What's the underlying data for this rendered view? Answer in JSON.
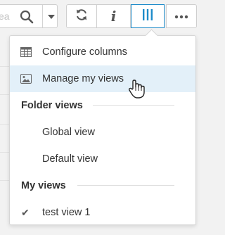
{
  "toolbar": {
    "search_partial_text": "ea",
    "buttons": [
      {
        "name": "refresh",
        "icon": "refresh-icon"
      },
      {
        "name": "info",
        "icon": "info-icon",
        "glyph": "i"
      },
      {
        "name": "columns",
        "icon": "columns-icon",
        "active": true
      },
      {
        "name": "more",
        "icon": "more-icon"
      }
    ]
  },
  "menu": {
    "items": [
      {
        "label": "Configure columns",
        "icon": "table-icon"
      },
      {
        "label": "Manage my views",
        "icon": "image-icon",
        "hovered": true
      }
    ],
    "folder_views": {
      "header": "Folder views",
      "items": [
        {
          "label": "Global view"
        },
        {
          "label": "Default view"
        }
      ]
    },
    "my_views": {
      "header": "My views",
      "items": [
        {
          "label": "test view 1",
          "checked": true
        }
      ]
    }
  },
  "colors": {
    "accent": "#1d8bc9",
    "hover_bg": "#e3f0f9",
    "background": "#f2f2f2"
  }
}
